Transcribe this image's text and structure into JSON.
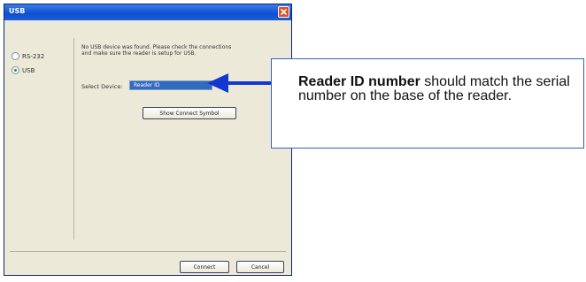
{
  "window": {
    "title": "USB"
  },
  "connection": {
    "options": [
      {
        "label": "RS-232",
        "checked": false
      },
      {
        "label": "USB",
        "checked": true
      }
    ]
  },
  "message": "No USB device was found. Please check the connections and make sure the reader is setup for USB.",
  "device": {
    "label": "Select Device:",
    "value": "Reader ID"
  },
  "buttons": {
    "show_connect": "Show Connect Symbol",
    "connect": "Connect",
    "cancel": "Cancel"
  },
  "callout": {
    "bold": "Reader ID number",
    "text": " should match the serial number on the base of the reader."
  },
  "colors": {
    "titlebar": "#0f4fd0",
    "selection": "#316ac5",
    "arrow": "#1238d0",
    "callout_border": "#2e62c8"
  }
}
